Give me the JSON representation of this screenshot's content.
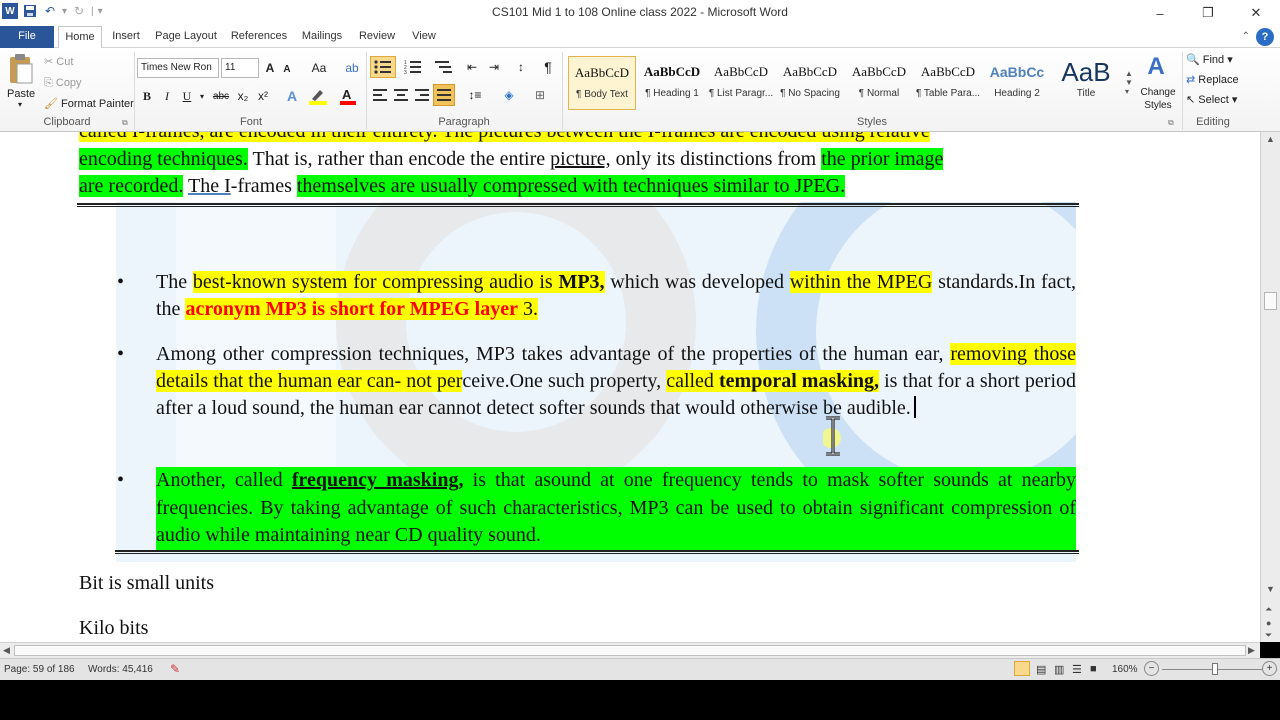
{
  "window": {
    "title": "CS101 Mid 1 to 108 Online class 2022 - Microsoft Word",
    "minimize": "–",
    "restore": "❐",
    "close": "✕"
  },
  "qat": {
    "word_icon": "W",
    "save_icon": "save-icon",
    "undo_icon": "↶",
    "redo_icon": "↻",
    "customize": "▾"
  },
  "tabs": [
    "File",
    "Home",
    "Insert",
    "Page Layout",
    "References",
    "Mailings",
    "Review",
    "View"
  ],
  "ribbon": {
    "clipboard": {
      "label": "Clipboard",
      "paste": "Paste",
      "cut": "Cut",
      "copy": "Copy",
      "format_painter": "Format Painter"
    },
    "font": {
      "label": "Font",
      "font_name": "Times New Ron",
      "font_size": "11",
      "bold": "B",
      "italic": "I",
      "underline": "U",
      "strike": "abc",
      "subscript": "x₂",
      "superscript": "x²",
      "grow": "A",
      "shrink": "A",
      "case": "Aa"
    },
    "paragraph": {
      "label": "Paragraph",
      "pilcrow": "¶"
    },
    "styles": {
      "label": "Styles",
      "items": [
        {
          "sample": "AaBbCcD",
          "name": "¶ Body Text"
        },
        {
          "sample": "AaBbCcD",
          "name": "¶ Heading 1"
        },
        {
          "sample": "AaBbCcD",
          "name": "¶ List Paragr..."
        },
        {
          "sample": "AaBbCcD",
          "name": "¶ No Spacing"
        },
        {
          "sample": "AaBbCcD",
          "name": "¶ Normal"
        },
        {
          "sample": "AaBbCcD",
          "name": "¶ Table Para..."
        },
        {
          "sample": "AaBbCc",
          "name": "Heading 2"
        },
        {
          "sample": "AaB",
          "name": "Title"
        }
      ],
      "change_styles": "Change Styles"
    },
    "editing": {
      "label": "Editing",
      "find": "Find",
      "replace": "Replace",
      "select": "Select"
    }
  },
  "document": {
    "top_para": {
      "line0": "called I-frames, are encoded in their entirety. The pictures between the I-frames are encoded using relative",
      "line1_a": "encoding techniques.",
      "line1_b": " That is, rather than encode the entire ",
      "line1_c": "picture,",
      "line1_d": " only its distinctions from ",
      "line1_e": "the prior image",
      "line2_a": "are recorded.",
      "line2_b": " ",
      "line2_c": "The I",
      "line2_d": "-frames ",
      "line2_e": "themselves are usually compressed with techniques similar to JPEG."
    },
    "bullet_char": "•",
    "b1": {
      "t1": "The ",
      "t2": "best-known system for compressing audio is ",
      "t3": "MP3,",
      "t4": " which was developed ",
      "t5": "within the MPEG",
      "t6": " standards.In fact, the ",
      "t7": "acronym MP3 is short for MPEG layer",
      "t8": " 3."
    },
    "b2": {
      "t1": "Among other compression techniques, MP3 takes advantage of the properties of the human ear, ",
      "t2": "removing those details that the human ear can- not per",
      "t3": "ceive.One such property, ",
      "t4": "called ",
      "t5": "temporal masking,",
      "t6": " is that for a short period after a loud sound, the human ear cannot detect softer sounds that would otherwise be audible."
    },
    "b3": {
      "t1": "Another, called ",
      "t2": "frequency masking,",
      "t3": " is that asound at one frequency tends to mask softer sounds at nearby frequencies. By taking advantage of such characteristics, MP3 can be used to obtain significant compression of audio while maintaining near CD quality sound."
    },
    "after1": "Bit is small units",
    "after2": "Kilo bits"
  },
  "status": {
    "page": "Page: 59 of 186",
    "words": "Words: 45,416",
    "zoom": "160%",
    "zoom_out": "−",
    "zoom_in": "+"
  },
  "colors": {
    "highlight_green": "#00ff00",
    "highlight_yellow": "#ffff00",
    "red_text": "#ff0000",
    "file_tab": "#2a5699"
  }
}
